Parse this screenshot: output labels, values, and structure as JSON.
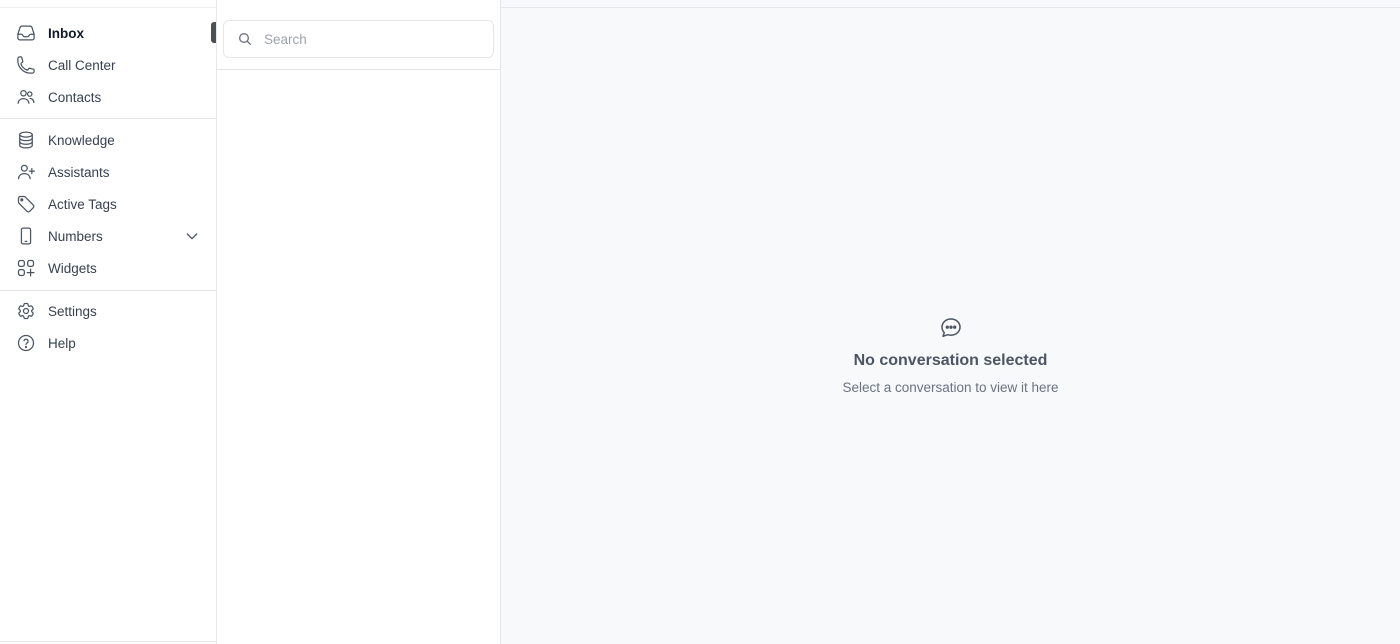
{
  "sidebar": {
    "primary": [
      {
        "label": "Inbox",
        "icon": "inbox-icon",
        "active": true
      },
      {
        "label": "Call Center",
        "icon": "phone-icon"
      },
      {
        "label": "Contacts",
        "icon": "users-icon"
      }
    ],
    "secondary": [
      {
        "label": "Knowledge",
        "icon": "database-icon"
      },
      {
        "label": "Assistants",
        "icon": "user-plus-icon"
      },
      {
        "label": "Active Tags",
        "icon": "tag-icon"
      },
      {
        "label": "Numbers",
        "icon": "device-phone-icon",
        "expandable": true
      },
      {
        "label": "Widgets",
        "icon": "widgets-icon"
      }
    ],
    "tertiary": [
      {
        "label": "Settings",
        "icon": "gear-icon"
      },
      {
        "label": "Help",
        "icon": "help-circle-icon"
      }
    ]
  },
  "search": {
    "placeholder": "Search",
    "value": "",
    "icon": "search-icon"
  },
  "main": {
    "empty_title": "No conversation selected",
    "empty_subtitle": "Select a conversation to view it here",
    "icon": "chat-bubble-icon"
  },
  "colors": {
    "sidebar_bg": "#ffffff",
    "main_bg": "#f8f9fb",
    "border": "#e5e7eb",
    "active_indicator": "#4b4f56",
    "text_primary": "#111827",
    "text_secondary": "#374151",
    "text_muted": "#6b7280"
  }
}
